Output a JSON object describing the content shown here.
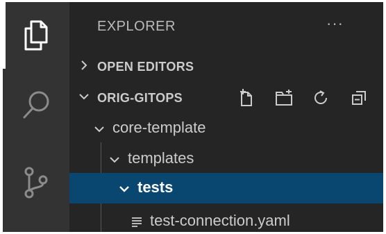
{
  "activity_bar": {
    "items": [
      {
        "icon": "files-icon",
        "active": true
      },
      {
        "icon": "search-icon",
        "active": false
      },
      {
        "icon": "source-control-icon",
        "active": false
      }
    ]
  },
  "sidebar": {
    "title": "EXPLORER",
    "more_actions": "···",
    "sections": [
      {
        "label": "OPEN EDITORS",
        "expanded": false
      },
      {
        "label": "ORIG-GITOPS",
        "expanded": true,
        "actions": [
          "new-file-icon",
          "new-folder-icon",
          "refresh-icon",
          "collapse-all-icon"
        ]
      }
    ],
    "tree": [
      {
        "label": "core-template",
        "type": "folder",
        "expanded": true,
        "depth": 1
      },
      {
        "label": "templates",
        "type": "folder",
        "expanded": true,
        "depth": 2
      },
      {
        "label": "tests",
        "type": "folder",
        "expanded": true,
        "depth": 3,
        "selected": true
      },
      {
        "label": "test-connection.yaml",
        "type": "file",
        "depth": 4
      }
    ]
  },
  "colors": {
    "activity_bar_bg": "#333333",
    "sidebar_bg": "#252526",
    "selection_bg": "#094771",
    "text": "#cccccc"
  }
}
